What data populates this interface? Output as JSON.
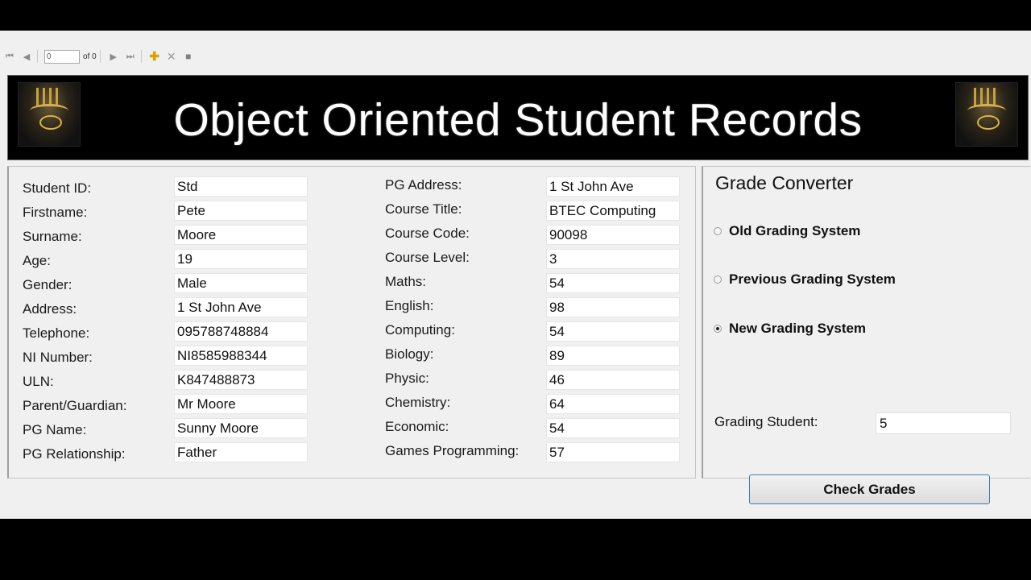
{
  "toolbar": {
    "position_value": "0",
    "of_label": "of 0",
    "icons": [
      "first-icon",
      "prev-icon",
      "next-icon",
      "last-icon",
      "add-icon",
      "delete-icon",
      "save-icon"
    ]
  },
  "banner": {
    "title": "Object Oriented Student Records"
  },
  "student": {
    "fields": [
      {
        "label": "Student ID:",
        "value": "Std"
      },
      {
        "label": "Firstname:",
        "value": "Pete"
      },
      {
        "label": "Surname:",
        "value": "Moore"
      },
      {
        "label": "Age:",
        "value": "19"
      },
      {
        "label": "Gender:",
        "value": "Male"
      },
      {
        "label": "Address:",
        "value": "1 St John Ave"
      },
      {
        "label": "Telephone:",
        "value": "095788748884"
      },
      {
        "label": "NI Number:",
        "value": "NI8585988344"
      },
      {
        "label": "ULN:",
        "value": "K847488873"
      },
      {
        "label": "Parent/Guardian:",
        "value": "Mr Moore"
      },
      {
        "label": "PG Name:",
        "value": "Sunny Moore"
      },
      {
        "label": "PG Relationship:",
        "value": "Father"
      }
    ],
    "course_fields": [
      {
        "label": "PG Address:",
        "value": "1 St John Ave"
      },
      {
        "label": "Course Title:",
        "value": "BTEC Computing"
      },
      {
        "label": "Course Code:",
        "value": "90098"
      },
      {
        "label": "Course Level:",
        "value": "3"
      },
      {
        "label": "Maths:",
        "value": "54"
      },
      {
        "label": "English:",
        "value": "98"
      },
      {
        "label": "Computing:",
        "value": "54"
      },
      {
        "label": "Biology:",
        "value": "89"
      },
      {
        "label": "Physic:",
        "value": "46"
      },
      {
        "label": "Chemistry:",
        "value": "64"
      },
      {
        "label": "Economic:",
        "value": "54"
      },
      {
        "label": "Games Programming:",
        "value": "57"
      }
    ]
  },
  "grade_converter": {
    "title": "Grade Converter",
    "options": [
      {
        "label": "Old Grading System",
        "checked": false
      },
      {
        "label": "Previous Grading System",
        "checked": false
      },
      {
        "label": "New Grading System",
        "checked": true
      }
    ],
    "grading_student_label": "Grading Student:",
    "grading_student_value": "5",
    "check_button_label": "Check Grades"
  }
}
